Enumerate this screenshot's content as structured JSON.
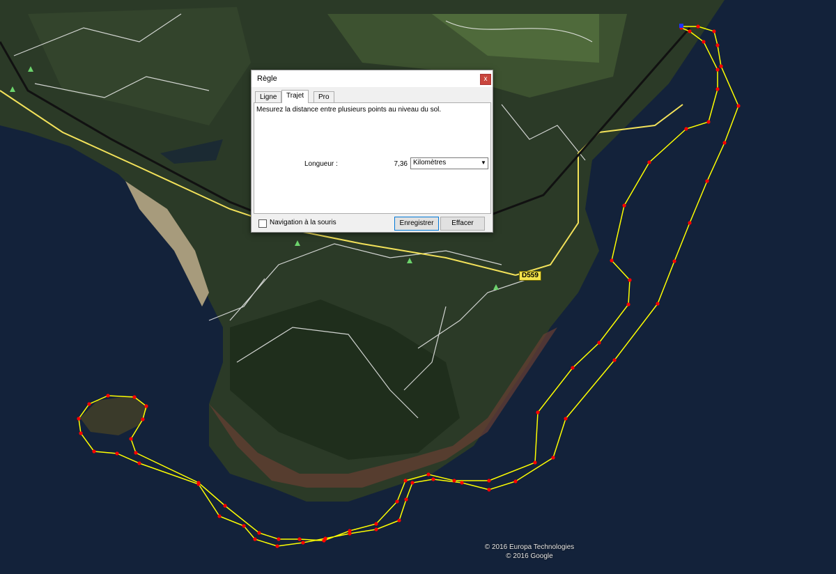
{
  "map": {
    "road_label": "D559",
    "attribution": [
      "© 2016 Europa Technologies",
      "© 2016 Google"
    ],
    "path_color": "#ffff00",
    "point_color": "#ff0000"
  },
  "dialog": {
    "title": "Règle",
    "close_label": "x",
    "tabs": [
      {
        "label": "Ligne",
        "active": false
      },
      {
        "label": "Trajet",
        "active": true
      },
      {
        "label": "Pro",
        "active": false
      }
    ],
    "description": "Mesurez la distance entre plusieurs points au niveau du sol.",
    "length_label": "Longueur :",
    "length_value": "7,36",
    "unit_selected": "Kilomètres",
    "mouse_nav_label": "Navigation à la souris",
    "mouse_nav_checked": false,
    "save_label": "Enregistrer",
    "clear_label": "Effacer"
  }
}
